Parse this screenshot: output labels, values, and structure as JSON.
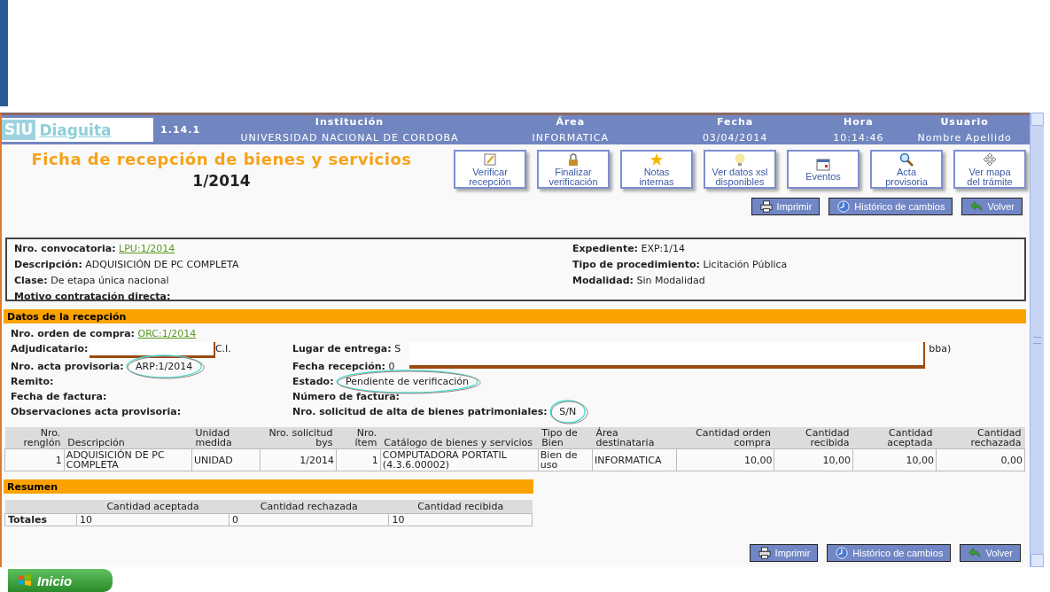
{
  "header": {
    "logo": {
      "badge": "SIU",
      "name": "Diaguita"
    },
    "version": "1.14.1",
    "columns": [
      {
        "label": "Institución",
        "value": "UNIVERSIDAD NACIONAL DE CORDOBA"
      },
      {
        "label": "Área",
        "value": "INFORMATICA"
      },
      {
        "label": "Fecha",
        "value": "03/04/2014"
      },
      {
        "label": "Hora",
        "value": "10:14:46"
      },
      {
        "label": "Usuario",
        "value": "Nombre Apellido"
      }
    ]
  },
  "title": "Ficha de recepción de bienes y servicios",
  "number": "1/2014",
  "actions": [
    {
      "label": "Verificar recepción"
    },
    {
      "label": "Finalizar verificación"
    },
    {
      "label": "Notas internas"
    },
    {
      "label": "Ver datos xsl disponibles"
    },
    {
      "label": "Eventos"
    },
    {
      "label": "Acta provisoria"
    },
    {
      "label": "Ver mapa del trámite"
    }
  ],
  "top_buttons": [
    "Imprimir",
    "Histórico de cambios",
    "Volver"
  ],
  "info": {
    "left": [
      {
        "label": "Nro. convocatoria:",
        "value": "LPU:1/2014",
        "link": true
      },
      {
        "label": "Descripción:",
        "value": "ADQUISICIÓN DE PC COMPLETA",
        "link": false
      },
      {
        "label": "Clase:",
        "value": "De etapa única nacional",
        "link": false
      },
      {
        "label": "Motivo contratación directa:"
      }
    ],
    "right": [
      {
        "label": "Expediente:",
        "value": "EXP:1/14",
        "link": false
      },
      {
        "label": "Tipo de procedimiento:",
        "value": "Licitación Pública",
        "link": false
      },
      {
        "label": "Modalidad:",
        "value": "Sin Modalidad",
        "link": false
      }
    ]
  },
  "reception": {
    "title": "Datos de la recepción",
    "order": {
      "label": "Nro. orden de compra:",
      "value": "ORC:1/2014",
      "link": true
    },
    "rows": [
      {
        "left": {
          "label": "Adjudicatario:",
          "value": "C.I."
        },
        "right": {
          "label": "Lugar de entrega:",
          "value": "S",
          "tail": "bba)"
        }
      },
      {
        "left": {
          "label": "Nro. acta provisoria:",
          "value": "ARP:1/2014"
        },
        "right": {
          "label": "Fecha recepción:",
          "value": "0"
        }
      },
      {
        "left": {
          "label": "Remito:"
        },
        "right": {
          "label": "Estado:",
          "value": "Pendiente de verificación"
        }
      },
      {
        "left": {
          "label": "Fecha de factura:"
        },
        "right": {
          "label": "Número de factura:"
        }
      },
      {
        "left": {
          "label": "Observaciones acta provisoria:"
        },
        "right": {
          "label": "Nro. solicitud de alta de bienes patrimoniales:",
          "value": "S/N"
        }
      }
    ]
  },
  "items": {
    "columns": [
      {
        "label": "Nro. renglón",
        "kind": "number"
      },
      {
        "label": "Descripción",
        "kind": "text"
      },
      {
        "label": "Unidad medida",
        "kind": "text"
      },
      {
        "label": "Nro. solicitud bys",
        "kind": "number"
      },
      {
        "label": "Nro. ítem",
        "kind": "number"
      },
      {
        "label": "Catálogo de bienes y servicios",
        "kind": "text"
      },
      {
        "label": "Tipo de Bien",
        "kind": "text"
      },
      {
        "label": "Área destinataria",
        "kind": "text"
      },
      {
        "label": "Cantidad orden compra",
        "kind": "number"
      },
      {
        "label": "Cantidad recibida",
        "kind": "number"
      },
      {
        "label": "Cantidad aceptada",
        "kind": "number"
      },
      {
        "label": "Cantidad rechazada",
        "kind": "number"
      }
    ],
    "rows": [
      [
        "1",
        "ADQUISICIÓN DE PC COMPLETA",
        "UNIDAD",
        "1/2014",
        "1",
        "COMPUTADORA PORTATIL (4.3.6.00002)",
        "Bien de uso",
        "INFORMATICA",
        "10,00",
        "10,00",
        "10,00",
        "0,00"
      ]
    ]
  },
  "summary": {
    "title": "Resumen",
    "columns": [
      "Cantidad aceptada",
      "Cantidad rechazada",
      "Cantidad recibida"
    ],
    "row_label": "Totales",
    "values": [
      "10",
      "0",
      "10"
    ]
  },
  "bottom_buttons": [
    "Imprimir",
    "Histórico de cambios",
    "Volver"
  ],
  "taskbar": {
    "start": "Inicio"
  }
}
